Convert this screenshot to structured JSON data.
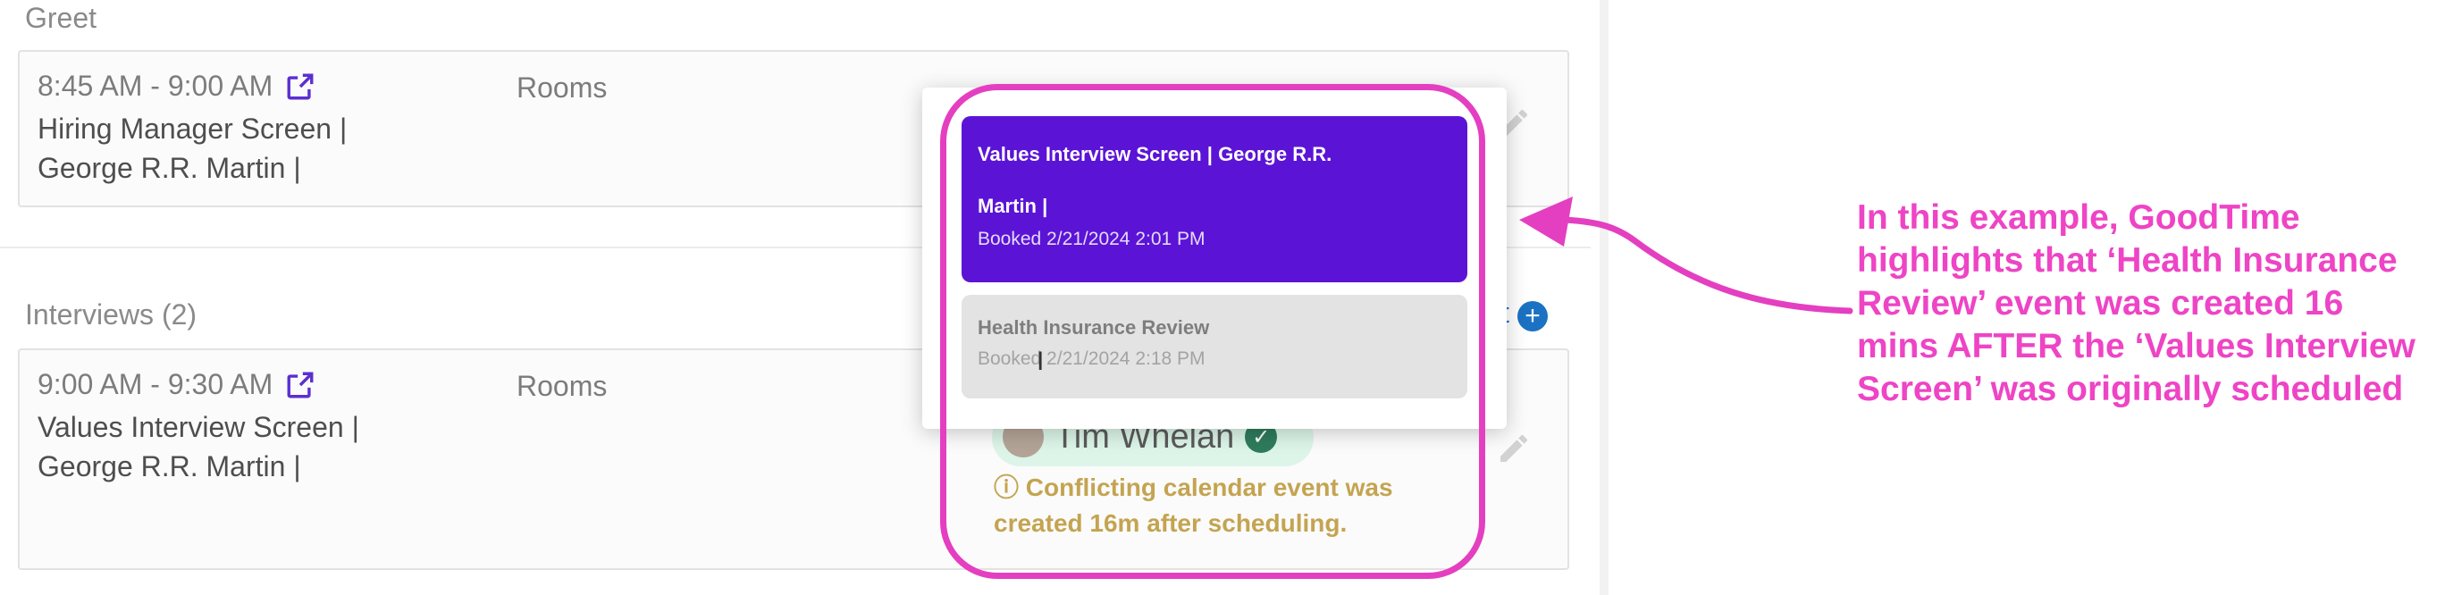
{
  "greet": {
    "section_label": "Greet",
    "time": "8:45 AM - 9:00 AM",
    "title_line1": "Hiring Manager Screen |",
    "title_line2": "George R.R. Martin |",
    "rooms_label": "Rooms"
  },
  "interviews": {
    "section_label": "Interviews (2)",
    "time": "9:00 AM - 9:30 AM",
    "title_line1": "Values Interview Screen |",
    "title_line2": "George R.R. Martin |",
    "rooms_label": "Rooms",
    "add_partial": "t",
    "interviewer_name": "Tim Whelan",
    "warning_line1": "ⓘ Conflicting calendar event was",
    "warning_line2": "created 16m after scheduling."
  },
  "popup": {
    "active_title_line1": "Values Interview Screen | George R.R.",
    "active_title_line2": "Martin |",
    "active_booked": "Booked 2/21/2024 2:01 PM",
    "item_title": "Health Insurance Review",
    "item_booked": "Booked 2/21/2024 2:18 PM"
  },
  "annotation": {
    "text": "In this example, GoodTime highlights that ‘Health Insurance Review’ event was created 16 mins AFTER the ‘Values Interview Screen’ was originally scheduled",
    "color": "#ee44c5"
  },
  "colors": {
    "popup_active_bg": "#5b14d6",
    "highlight_border": "#e43fc1",
    "warning_text": "#c4a451"
  },
  "icons": [
    "external-link-icon",
    "pencil-icon",
    "add-circle-icon",
    "check-circle-icon",
    "text-cursor-icon",
    "arrow-icon"
  ]
}
